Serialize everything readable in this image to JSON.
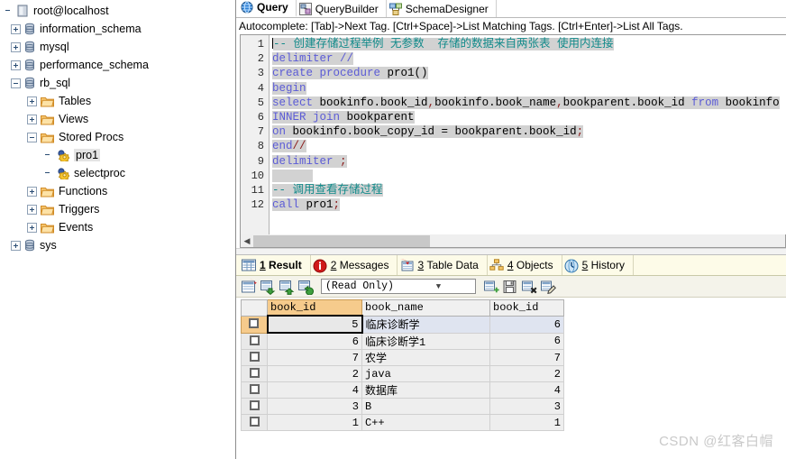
{
  "sidebar": {
    "nodes": [
      {
        "label": "root@localhost",
        "icon": "server-icon",
        "depth": 0,
        "expander": "none",
        "selected": false
      },
      {
        "label": "information_schema",
        "icon": "database-icon",
        "depth": 1,
        "expander": "plus",
        "selected": false
      },
      {
        "label": "mysql",
        "icon": "database-icon",
        "depth": 1,
        "expander": "plus",
        "selected": false
      },
      {
        "label": "performance_schema",
        "icon": "database-icon",
        "depth": 1,
        "expander": "plus",
        "selected": false
      },
      {
        "label": "rb_sql",
        "icon": "database-icon",
        "depth": 1,
        "expander": "minus",
        "selected": false
      },
      {
        "label": "Tables",
        "icon": "folder-icon",
        "depth": 2,
        "expander": "plus",
        "selected": false
      },
      {
        "label": "Views",
        "icon": "folder-icon",
        "depth": 2,
        "expander": "plus",
        "selected": false
      },
      {
        "label": "Stored Procs",
        "icon": "folder-icon",
        "depth": 2,
        "expander": "minus",
        "selected": false
      },
      {
        "label": "pro1",
        "icon": "procedure-icon",
        "depth": 3,
        "expander": "none",
        "selected": true
      },
      {
        "label": "selectproc",
        "icon": "procedure-icon",
        "depth": 3,
        "expander": "none",
        "selected": false
      },
      {
        "label": "Functions",
        "icon": "folder-icon",
        "depth": 2,
        "expander": "plus",
        "selected": false
      },
      {
        "label": "Triggers",
        "icon": "folder-icon",
        "depth": 2,
        "expander": "plus",
        "selected": false
      },
      {
        "label": "Events",
        "icon": "folder-icon",
        "depth": 2,
        "expander": "plus",
        "selected": false
      },
      {
        "label": "sys",
        "icon": "database-icon",
        "depth": 1,
        "expander": "plus",
        "selected": false
      }
    ]
  },
  "tabs": [
    {
      "label": "Query",
      "icon": "globe-icon",
      "active": true
    },
    {
      "label": "QueryBuilder",
      "icon": "querybuilder-icon",
      "active": false
    },
    {
      "label": "SchemaDesigner",
      "icon": "schemadesigner-icon",
      "active": false
    }
  ],
  "hint": "Autocomplete: [Tab]->Next Tag. [Ctrl+Space]->List Matching Tags. [Ctrl+Enter]->List All Tags.",
  "editor": {
    "line_numbers": [
      "1",
      "2",
      "3",
      "4",
      "5",
      "6",
      "7",
      "8",
      "9",
      "10",
      "11",
      "12"
    ],
    "lines": [
      {
        "n": 1,
        "tokens": [
          {
            "t": "-- 创建存储过程举例 无参数  存储的数据来自两张表 使用内连接",
            "c": "cm"
          }
        ]
      },
      {
        "n": 2,
        "tokens": [
          {
            "t": "delimiter //",
            "c": "kw"
          }
        ]
      },
      {
        "n": 3,
        "tokens": [
          {
            "t": "create procedure ",
            "c": "kw"
          },
          {
            "t": "pro1()",
            "c": "pl"
          }
        ]
      },
      {
        "n": 4,
        "tokens": [
          {
            "t": "begin",
            "c": "kw"
          }
        ]
      },
      {
        "n": 5,
        "tokens": [
          {
            "t": "select ",
            "c": "kw"
          },
          {
            "t": "bookinfo.book_id",
            "c": "pl"
          },
          {
            "t": ",",
            "c": "pn"
          },
          {
            "t": "bookinfo.book_name",
            "c": "pl"
          },
          {
            "t": ",",
            "c": "pn"
          },
          {
            "t": "bookparent.book_id ",
            "c": "pl"
          },
          {
            "t": "from ",
            "c": "kw"
          },
          {
            "t": "bookinfo",
            "c": "pl"
          }
        ]
      },
      {
        "n": 6,
        "tokens": [
          {
            "t": "INNER join ",
            "c": "kw"
          },
          {
            "t": "bookparent",
            "c": "pl"
          }
        ]
      },
      {
        "n": 7,
        "tokens": [
          {
            "t": "on ",
            "c": "kw"
          },
          {
            "t": "bookinfo.book_copy_id = bookparent.book_id",
            "c": "pl"
          },
          {
            "t": ";",
            "c": "pn"
          }
        ]
      },
      {
        "n": 8,
        "tokens": [
          {
            "t": "end",
            "c": "kw"
          },
          {
            "t": "//",
            "c": "pn"
          }
        ]
      },
      {
        "n": 9,
        "tokens": [
          {
            "t": "delimiter ",
            "c": "kw"
          },
          {
            "t": ";",
            "c": "pn"
          }
        ]
      },
      {
        "n": 10,
        "tokens": [
          {
            "t": "",
            "c": "pl"
          }
        ]
      },
      {
        "n": 11,
        "tokens": [
          {
            "t": "-- 调用查看存储过程",
            "c": "cm"
          }
        ]
      },
      {
        "n": 12,
        "tokens": [
          {
            "t": "call ",
            "c": "kw"
          },
          {
            "t": "pro1",
            "c": "pl"
          },
          {
            "t": ";",
            "c": "pn"
          }
        ]
      }
    ]
  },
  "result_tabs": [
    {
      "num": "1",
      "label": "Result",
      "icon": "result-grid-icon",
      "active": true
    },
    {
      "num": "2",
      "label": "Messages",
      "icon": "info-icon",
      "active": false
    },
    {
      "num": "3",
      "label": "Table Data",
      "icon": "table-data-icon",
      "active": false
    },
    {
      "num": "4",
      "label": "Objects",
      "icon": "objects-icon",
      "active": false
    },
    {
      "num": "5",
      "label": "History",
      "icon": "history-icon",
      "active": false
    }
  ],
  "result_toolbar": {
    "left_icons": [
      "grid-red-icon",
      "export-grid-icon",
      "import-grid-icon",
      "refresh-grid-icon"
    ],
    "mode_value": "(Read Only)",
    "right_icons": [
      "add-row-icon",
      "save-icon",
      "delete-row-icon",
      "edit-row-icon"
    ]
  },
  "grid": {
    "columns": [
      "book_id",
      "book_name",
      "book_id"
    ],
    "selected_column_index": 0,
    "rows": [
      {
        "book_id": "5",
        "book_name": "临床诊断学",
        "book_id2": "6",
        "selected": true
      },
      {
        "book_id": "6",
        "book_name": "临床诊断学1",
        "book_id2": "6",
        "selected": false
      },
      {
        "book_id": "7",
        "book_name": "农学",
        "book_id2": "7",
        "selected": false
      },
      {
        "book_id": "2",
        "book_name": "java",
        "book_id2": "2",
        "selected": false
      },
      {
        "book_id": "4",
        "book_name": "数据库",
        "book_id2": "4",
        "selected": false
      },
      {
        "book_id": "3",
        "book_name": "B",
        "book_id2": "3",
        "selected": false
      },
      {
        "book_id": "1",
        "book_name": "C++",
        "book_id2": "1",
        "selected": false
      }
    ]
  },
  "watermark": "CSDN @红客白帽",
  "colors": {
    "selection_orange": "#f6cb8c",
    "keyword_blue": "#5b5bd6",
    "comment_teal": "#118a8a",
    "row_selected_blue": "#dfe4f0",
    "tab_bg_cream": "#fdfbe8"
  }
}
